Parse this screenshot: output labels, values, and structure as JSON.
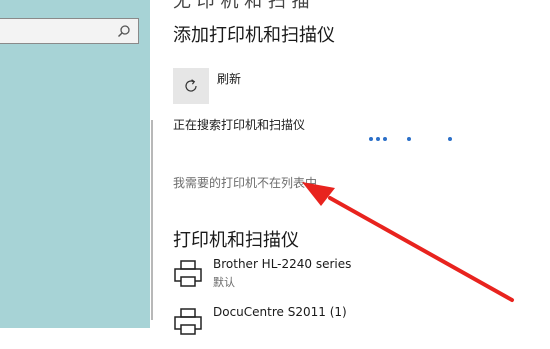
{
  "left_pane": {
    "search_icon": "search-icon"
  },
  "header": {
    "cut_title": "无 印 机 和 扫 描"
  },
  "add_section": {
    "title": "添加打印机和扫描仪",
    "refresh_label": "刷新",
    "refresh_icon": "refresh-icon",
    "searching_text": "正在搜索打印机和扫描仪",
    "not_listed_link": "我需要的打印机不在列表中"
  },
  "printers_section": {
    "title": "打印机和扫描仪",
    "printers": [
      {
        "name": "Brother HL-2240 series",
        "status": "默认",
        "icon": "printer-icon"
      },
      {
        "name": "DocuCentre S2011 (1)",
        "status": "",
        "icon": "printer-icon"
      }
    ]
  },
  "annotation": {
    "arrow_color": "#e8231e",
    "accent": "#2b6fc8"
  }
}
